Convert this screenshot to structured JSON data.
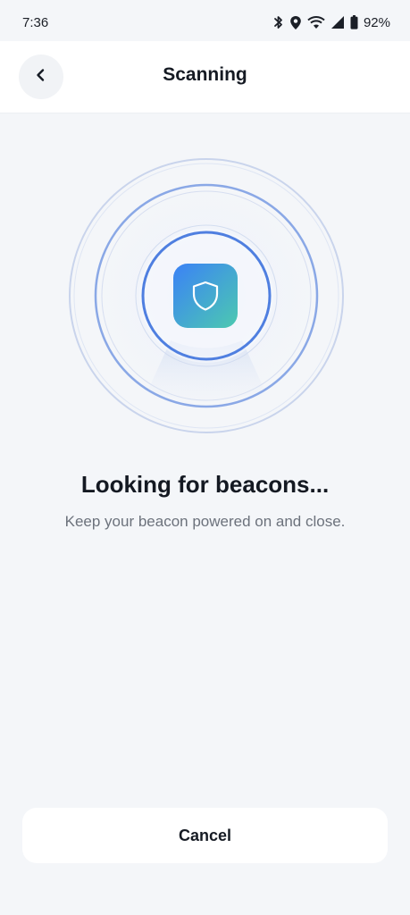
{
  "status_bar": {
    "time": "7:36",
    "battery": "92%",
    "icons": [
      "bluetooth-icon",
      "location-icon",
      "wifi-icon",
      "signal-icon",
      "battery-icon"
    ]
  },
  "header": {
    "title": "Scanning",
    "back_icon": "chevron-left-icon"
  },
  "scanner": {
    "icon": "shield-icon",
    "gradient_start": "#3b82f6",
    "gradient_end": "#4cc9b0",
    "ring_color": "#4f7fe0"
  },
  "main": {
    "headline": "Looking for beacons...",
    "subtitle": "Keep your beacon powered on and close."
  },
  "footer": {
    "cancel_label": "Cancel"
  }
}
